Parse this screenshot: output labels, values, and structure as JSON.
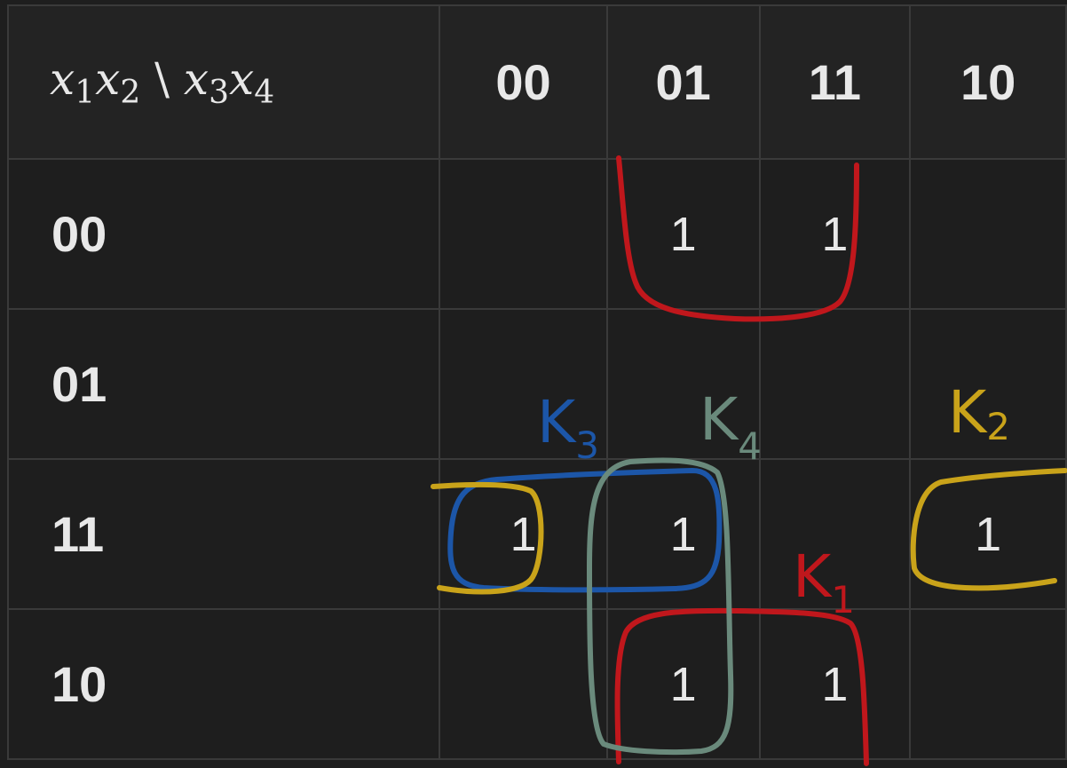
{
  "kmap": {
    "corner": {
      "row_vars": [
        {
          "v": "x",
          "i": "1"
        },
        {
          "v": "x",
          "i": "2"
        }
      ],
      "separator": "\\",
      "col_vars": [
        {
          "v": "x",
          "i": "3"
        },
        {
          "v": "x",
          "i": "4"
        }
      ]
    },
    "col_labels": [
      "00",
      "01",
      "11",
      "10"
    ],
    "rows": [
      {
        "label": "00",
        "cells": [
          "",
          "1",
          "1",
          ""
        ]
      },
      {
        "label": "01",
        "cells": [
          "",
          "",
          "",
          ""
        ]
      },
      {
        "label": "11",
        "cells": [
          "1",
          "1",
          "",
          "1"
        ]
      },
      {
        "label": "10",
        "cells": [
          "",
          "1",
          "1",
          ""
        ]
      }
    ]
  },
  "groups": [
    {
      "name": "K",
      "subscript": "1",
      "color": "#c0171c"
    },
    {
      "name": "K",
      "subscript": "2",
      "color": "#c9a31a"
    },
    {
      "name": "K",
      "subscript": "3",
      "color": "#1c56a8"
    },
    {
      "name": "K",
      "subscript": "4",
      "color": "#6a8a7c"
    }
  ]
}
